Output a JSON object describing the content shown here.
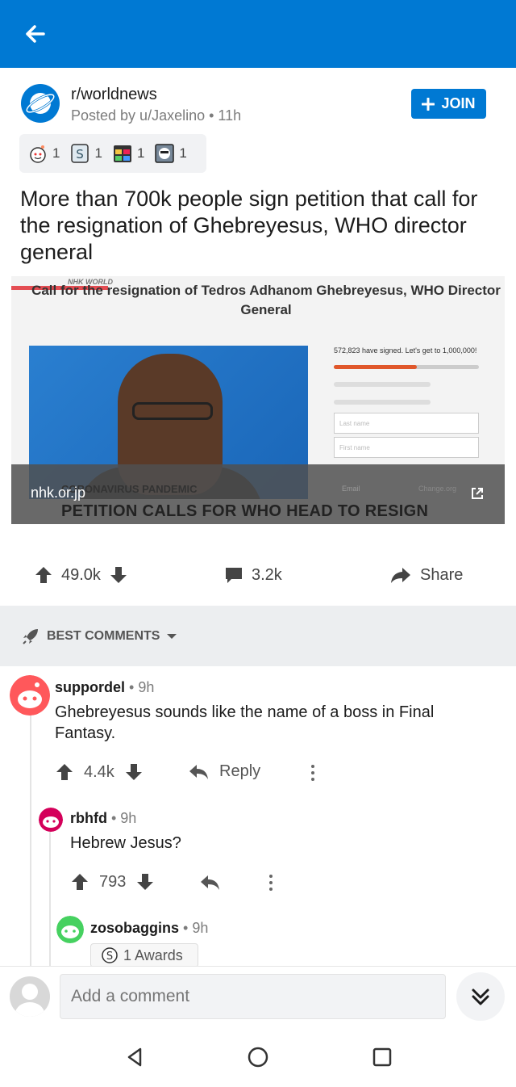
{
  "header": {
    "back_icon": "arrow-left-icon",
    "color": "#0079d3"
  },
  "post": {
    "subreddit": "r/worldnews",
    "posted_by": "Posted by u/Jaxelino • 11h",
    "join_label": "JOIN",
    "awards": [
      {
        "icon": "wholesome-award-icon",
        "count": "1"
      },
      {
        "icon": "silver-award-icon",
        "count": "1"
      },
      {
        "icon": "calendar-award-icon",
        "count": "1"
      },
      {
        "icon": "face-award-icon",
        "count": "1"
      }
    ],
    "title": "More than 700k people sign petition that call for the resignation of Ghebreyesus, WHO director general",
    "media": {
      "petition_title": "Call for the resignation of Tedros Adhanom Ghebreyesus, WHO Director General",
      "watermark": "NHK WORLD",
      "signed_text": "572,823 have signed. Let's get to 1,000,000!",
      "progress": 0.57,
      "last_name_placeholder": "Last name",
      "first_name_placeholder": "First name",
      "email_placeholder": "Email",
      "site_tag": "Change.org",
      "banner_small": "CORONAVIRUS PANDEMIC",
      "banner": "PETITION CALLS FOR WHO HEAD TO RESIGN",
      "domain": "nhk.or.jp"
    },
    "votes": "49.0k",
    "comments": "3.2k",
    "share_label": "Share"
  },
  "comments_section": {
    "sort_label": "BEST COMMENTS"
  },
  "comments": [
    {
      "user": "suppordel",
      "meta": " • 9h",
      "body": "Ghebreyesus sounds like the name of a boss in Final Fantasy.",
      "votes": "4.4k",
      "reply_label": "Reply"
    },
    {
      "user": "rbhfd",
      "meta": " • 9h",
      "body": "Hebrew Jesus?",
      "votes": "793"
    },
    {
      "user": "zosobaggins",
      "meta": " • 9h",
      "awards_label": "1 Awards"
    }
  ],
  "composer": {
    "placeholder": "Add a comment"
  }
}
